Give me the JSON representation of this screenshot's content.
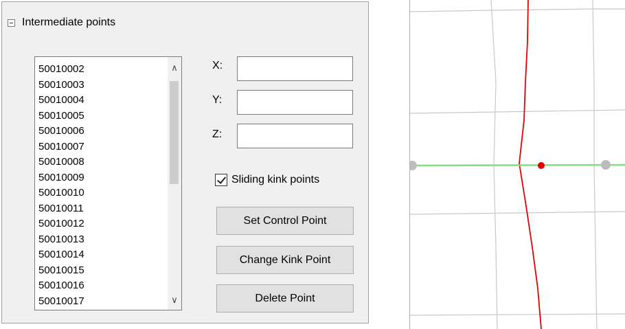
{
  "group": {
    "title": "Intermediate points"
  },
  "points_list": {
    "items": [
      "50010002",
      "50010003",
      "50010004",
      "50010005",
      "50010006",
      "50010007",
      "50010008",
      "50010009",
      "50010010",
      "50010011",
      "50010012",
      "50010013",
      "50010014",
      "50010015",
      "50010016",
      "50010017"
    ]
  },
  "coords": {
    "x_label": "X:",
    "y_label": "Y:",
    "z_label": "Z:",
    "x_value": "",
    "y_value": "",
    "z_value": ""
  },
  "sliding_kink": {
    "label": "Sliding kink points",
    "checked": true
  },
  "buttons": {
    "set_control": "Set Control Point",
    "change_kink": "Change Kink Point",
    "delete": "Delete Point"
  },
  "colors": {
    "grid": "#c8c8c8",
    "red_line": "#e60000",
    "green_line": "#7fe07f",
    "control_point": "#bdbdbd",
    "kink_point": "#e60000"
  }
}
